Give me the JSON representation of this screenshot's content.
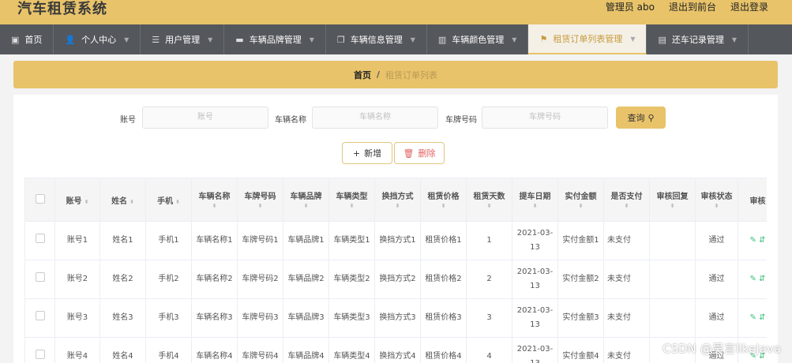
{
  "app_title": "汽车租赁系统",
  "header_links": [
    "管理员 abo",
    "退出到前台",
    "退出登录"
  ],
  "nav": [
    {
      "icon": "home-icon",
      "glyph": "▣",
      "label": "首页",
      "has_dropdown": false
    },
    {
      "icon": "user-icon",
      "glyph": "👤",
      "label": "个人中心",
      "has_dropdown": true
    },
    {
      "icon": "list-icon",
      "glyph": "☰",
      "label": "用户管理",
      "has_dropdown": true
    },
    {
      "icon": "car-icon",
      "glyph": "▬",
      "label": "车辆品牌管理",
      "has_dropdown": true
    },
    {
      "icon": "copy-icon",
      "glyph": "❐",
      "label": "车辆信息管理",
      "has_dropdown": true
    },
    {
      "icon": "chart-icon",
      "glyph": "▥",
      "label": "车辆颜色管理",
      "has_dropdown": true
    },
    {
      "icon": "flag-icon",
      "glyph": "⚑",
      "label": "租赁订单列表管理",
      "has_dropdown": true,
      "active": true
    },
    {
      "icon": "doc-icon",
      "glyph": "▤",
      "label": "还车记录管理",
      "has_dropdown": true
    }
  ],
  "breadcrumb": {
    "home": "首页",
    "sep": "/",
    "current": "租赁订单列表"
  },
  "search": {
    "account_label": "账号",
    "account_placeholder": "账号",
    "carname_label": "车辆名称",
    "carname_placeholder": "车辆名称",
    "plate_label": "车牌号码",
    "plate_placeholder": "车牌号码",
    "query_label": "查询"
  },
  "actions": {
    "add_label": "新增",
    "delete_label": "删除"
  },
  "table": {
    "columns": [
      "账号",
      "姓名",
      "手机",
      "车辆名称",
      "车牌号码",
      "车辆品牌",
      "车辆类型",
      "换挡方式",
      "租赁价格",
      "租赁天数",
      "提车日期",
      "实付金额",
      "是否支付",
      "审核回复",
      "审核状态",
      "审核"
    ],
    "rows": [
      [
        "账号1",
        "姓名1",
        "手机1",
        "车辆名称1",
        "车牌号码1",
        "车辆品牌1",
        "车辆类型1",
        "换挡方式1",
        "租赁价格1",
        "1",
        "2021-03-13",
        "实付金额1",
        "未支付",
        "",
        "通过"
      ],
      [
        "账号2",
        "姓名2",
        "手机2",
        "车辆名称2",
        "车牌号码2",
        "车辆品牌2",
        "车辆类型2",
        "换挡方式2",
        "租赁价格2",
        "2",
        "2021-03-13",
        "实付金额2",
        "未支付",
        "",
        "通过"
      ],
      [
        "账号3",
        "姓名3",
        "手机3",
        "车辆名称3",
        "车牌号码3",
        "车辆品牌3",
        "车辆类型3",
        "换挡方式3",
        "租赁价格3",
        "3",
        "2021-03-13",
        "实付金额3",
        "未支付",
        "",
        "通过"
      ],
      [
        "账号4",
        "姓名4",
        "手机4",
        "车辆名称4",
        "车牌号码4",
        "车辆品牌4",
        "车辆类型4",
        "换挡方式4",
        "租赁价格4",
        "4",
        "2021-03-13",
        "实付金额4",
        "未支付",
        "",
        "通过"
      ]
    ]
  },
  "watermark": "CSDN @昊言likeJava",
  "colors": {
    "accent": "#e8c36a",
    "nav_bg": "#54575c",
    "delete": "#e26262",
    "op_icon": "#3bbf7a"
  }
}
